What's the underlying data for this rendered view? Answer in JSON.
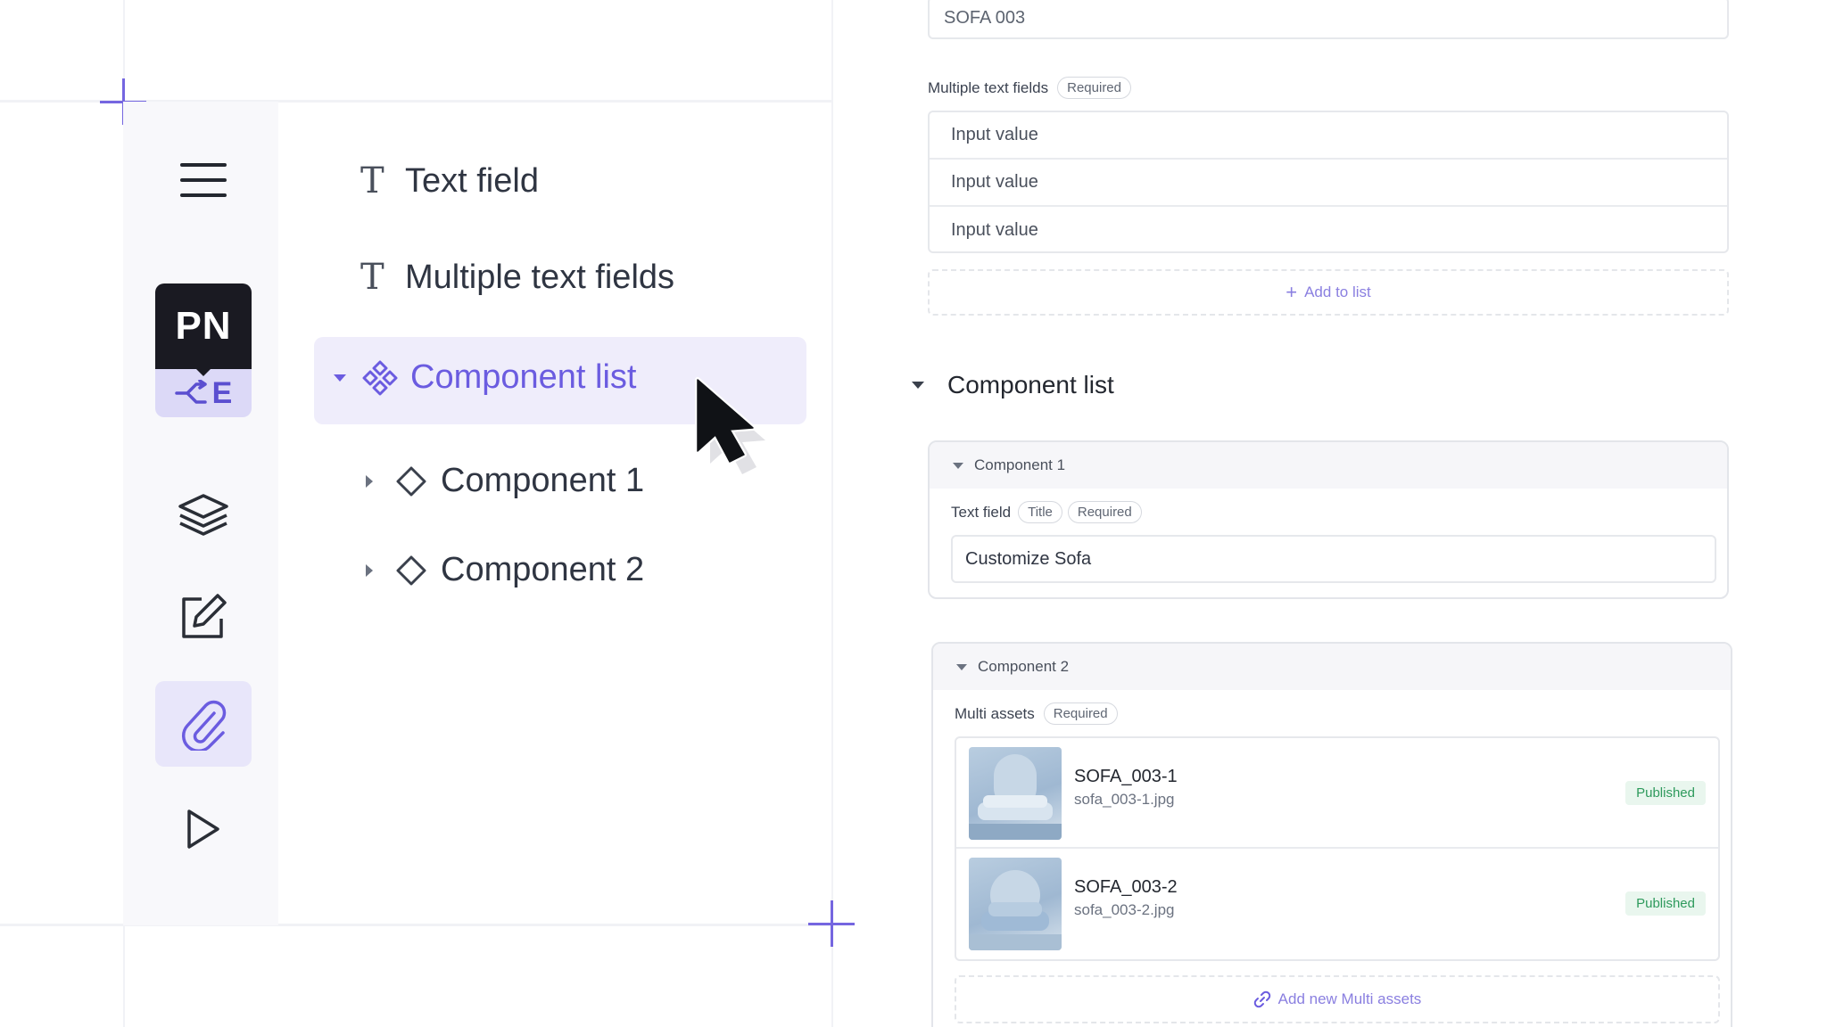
{
  "nav": {
    "logo_top": "PN",
    "logo_bottom": "E"
  },
  "tree": {
    "items": [
      {
        "label": "Text field"
      },
      {
        "label": "Multiple text fields"
      },
      {
        "label": "Component list"
      },
      {
        "label": "Component 1"
      },
      {
        "label": "Component 2"
      }
    ]
  },
  "form": {
    "top_input_value": "SOFA 003",
    "multiple_text_fields": {
      "label": "Multiple text fields",
      "tag": "Required",
      "rows": [
        "Input value",
        "Input value",
        "Input value"
      ],
      "add_label": "Add to list"
    },
    "component_list": {
      "title": "Component list",
      "component1": {
        "title": "Component 1",
        "field_label": "Text field",
        "tags": [
          "Title",
          "Required"
        ],
        "value": "Customize Sofa"
      },
      "component2": {
        "title": "Component 2",
        "field_label": "Multi assets",
        "tag": "Required",
        "assets": [
          {
            "name": "SOFA_003-1",
            "file": "sofa_003-1.jpg",
            "status": "Published"
          },
          {
            "name": "SOFA_003-2",
            "file": "sofa_003-2.jpg",
            "status": "Published"
          }
        ],
        "add_label": "Add new Multi assets"
      }
    }
  },
  "colors": {
    "accent": "#6b5ce0",
    "published_bg": "#e9f6ee",
    "published_text": "#2e9a5c"
  }
}
